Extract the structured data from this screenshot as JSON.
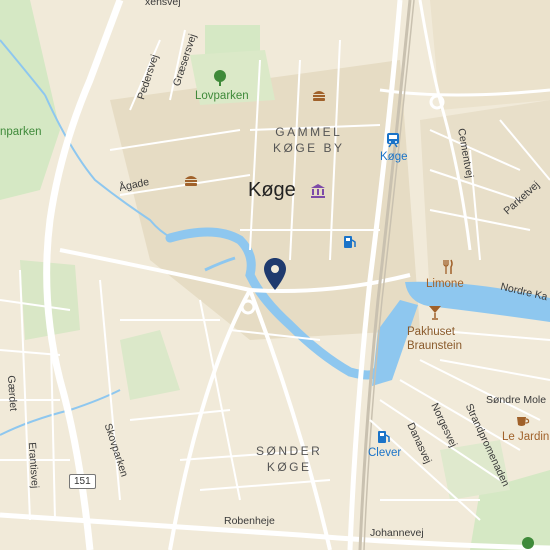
{
  "map": {
    "city": "Køge",
    "districts": {
      "gammel_line1": "GAMMEL",
      "gammel_line2": "KØGE BY",
      "sonder_line1": "SØNDER",
      "sonder_line2": "KØGE"
    },
    "pois": {
      "lovparken": "Lovparken",
      "nparken": "nparken",
      "koge_station": "Køge",
      "limone": "Limone",
      "pakhuset_line1": "Pakhuset",
      "pakhuset_line2": "Braunstein",
      "le_jardin": "Le Jardin",
      "clever": "Clever"
    },
    "streets": {
      "axensvej": "xensvej",
      "pedersvej": "Pedersvej",
      "graesersvej": "Græsersvej",
      "agade": "Ågade",
      "cementvej": "Cementvej",
      "parketvej": "Parketvej",
      "nordre_ka": "Nordre Ka",
      "sondre_mole": "Søndre Mole",
      "strandpromenaden": "Strandpromenaden",
      "norgesvej": "Norgesvej",
      "danasvej": "Danasvej",
      "skovparken": "Skovparken",
      "erantisvej": "Erantisvej",
      "gaerdet": "Gærdet",
      "robenheje": "Robenheje",
      "johannevej": "Johannevej"
    },
    "road_shield": "151",
    "colors": {
      "land": "#f1ead9",
      "park": "#d5e8c4",
      "water": "#8ec7ef",
      "road": "#ffffff",
      "marker": "#1f3a6e"
    }
  }
}
